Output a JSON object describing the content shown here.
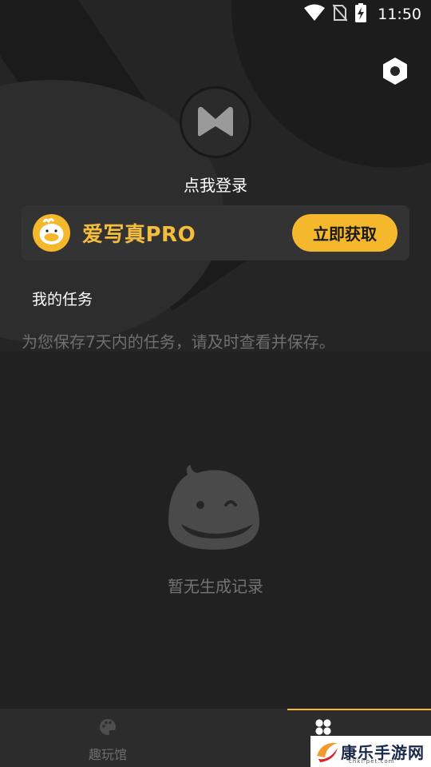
{
  "status_bar": {
    "time": "11:50",
    "icons": [
      "wifi-icon",
      "no-sim-icon",
      "battery-charging-icon"
    ]
  },
  "header": {
    "settings_icon": "settings-icon",
    "avatar_icon": "app-logo-m-icon",
    "login_text": "点我登录"
  },
  "pro_card": {
    "title": "爱写真PRO",
    "logo_icon": "duck-mascot-icon",
    "button_label": "立即获取"
  },
  "tasks": {
    "heading": "我的任务",
    "hint": "为您保存7天内的任务，请及时查看并保存。"
  },
  "empty_state": {
    "icon": "blob-mascot-icon",
    "text": "暂无生成记录"
  },
  "bottom_nav": {
    "tabs": [
      {
        "label": "趣玩馆",
        "icon": "palette-icon",
        "active": false
      },
      {
        "label": "",
        "icon": "clover-grid-icon",
        "active": true
      }
    ]
  },
  "watermark": {
    "text": "康乐手游网",
    "sub": "chkl-pet.com"
  },
  "colors": {
    "accent": "#f5b72b",
    "background": "#212121",
    "card": "#333333",
    "muted_text": "#6f6f6f"
  }
}
